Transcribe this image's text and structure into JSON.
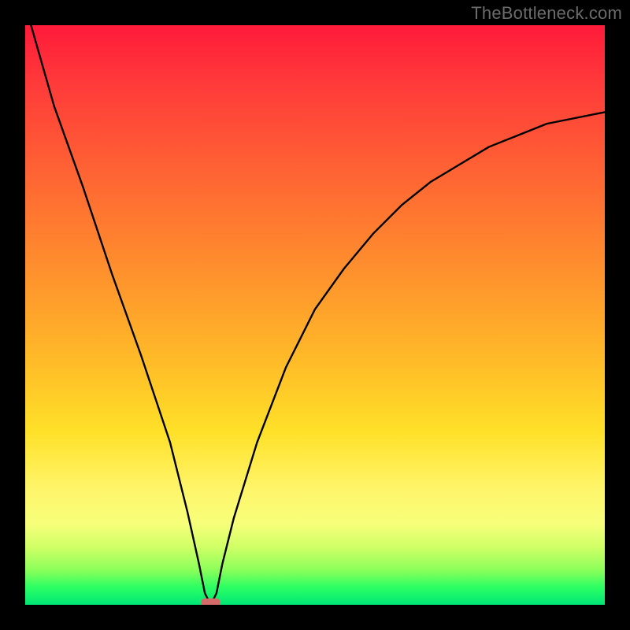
{
  "watermark": "TheBottleneck.com",
  "chart_data": {
    "type": "line",
    "title": "",
    "xlabel": "",
    "ylabel": "",
    "xlim": [
      0,
      100
    ],
    "ylim": [
      0,
      100
    ],
    "grid": false,
    "series": [
      {
        "name": "curve",
        "x": [
          1,
          5,
          10,
          15,
          20,
          25,
          28,
          30,
          31,
          32,
          33,
          34,
          36,
          40,
          45,
          50,
          55,
          60,
          65,
          70,
          75,
          80,
          85,
          90,
          95,
          100
        ],
        "values": [
          100,
          86,
          72,
          57,
          43,
          28,
          16,
          7,
          2,
          0,
          2,
          7,
          15,
          28,
          41,
          51,
          58,
          64,
          69,
          73,
          76,
          79,
          81,
          83,
          84,
          85
        ]
      }
    ],
    "minimum_marker": {
      "x": 32,
      "y": 0
    },
    "gradient_stops": [
      {
        "pos": 0.0,
        "color": "#ff1a3a"
      },
      {
        "pos": 0.5,
        "color": "#ffbb28"
      },
      {
        "pos": 0.85,
        "color": "#f7ff7a"
      },
      {
        "pos": 1.0,
        "color": "#00e676"
      }
    ]
  }
}
